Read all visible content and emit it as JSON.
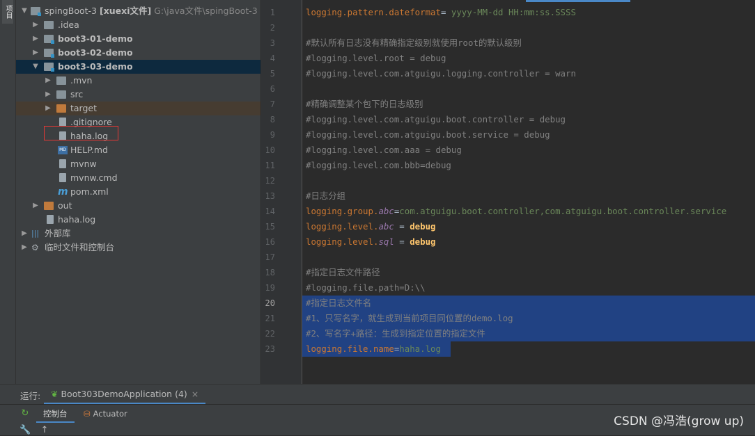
{
  "left_strip": {
    "tab": "项目"
  },
  "tree": {
    "root": {
      "name": "spingBoot-3",
      "tag": "[xuexi文件]",
      "path": "G:\\java文件\\spingBoot-3"
    },
    "idea": ".idea",
    "m1": "boot3-01-demo",
    "m2": "boot3-02-demo",
    "m3": "boot3-03-demo",
    "mvn": ".mvn",
    "src": "src",
    "target": "target",
    "gitignore": ".gitignore",
    "haha_inner": "haha.log",
    "help": "HELP.md",
    "mvnw": "mvnw",
    "mvnwcmd": "mvnw.cmd",
    "pom": "pom.xml",
    "out": "out",
    "haha_outer": "haha.log",
    "ext": "外部库",
    "scratch": "临时文件和控制台"
  },
  "editor": {
    "line_numbers": [
      "1",
      "2",
      "3",
      "4",
      "5",
      "6",
      "7",
      "8",
      "9",
      "10",
      "11",
      "12",
      "13",
      "14",
      "15",
      "16",
      "17",
      "18",
      "19",
      "20",
      "21",
      "22",
      "23"
    ],
    "current_line": "20",
    "l1_key": "logging.pattern.dateformat",
    "l1_eq": "= ",
    "l1_val": "yyyy-MM-dd HH:mm:ss.SSSS",
    "l3": "#默认所有日志没有精确指定级别就使用root的默认级别",
    "l4": "#logging.level.root = debug",
    "l5": "#logging.level.com.atguigu.logging.controller = warn",
    "l7": "#精确调整某个包下的日志级别",
    "l8": "#logging.level.com.atguigu.boot.controller = debug",
    "l9": "#logging.level.com.atguigu.boot.service = debug",
    "l10": "#logging.level.com.aaa = debug",
    "l11": "#logging.level.com.bbb=debug",
    "l13": "#日志分组",
    "l14_key": "logging.group.",
    "l14_ital": "abc",
    "l14_eq": "=",
    "l14_val": "com.atguigu.boot.controller,com.atguigu.boot.controller.service",
    "l15_key": "logging.level.",
    "l15_ital": "abc",
    "l15_eq": " = ",
    "l15_val": "debug",
    "l16_key": "logging.level.",
    "l16_ital": "sql",
    "l16_eq": " = ",
    "l16_val": "debug",
    "l18": "#指定日志文件路径",
    "l19": "#logging.file.path=D:\\\\",
    "l20": "#指定日志文件名",
    "l21": "#1、只写名字，就生成到当前项目同位置的demo.log",
    "l22": "#2、写名字+路径：生成到指定位置的指定文件",
    "l23_key": "logging.file.name",
    "l23_eq": "=",
    "l23_val": "haha.log"
  },
  "bottom": {
    "run_label": "运行:",
    "run_tab": "Boot303DemoApplication (4)",
    "console_tab": "控制台",
    "actuator_tab": "Actuator"
  },
  "watermark": "CSDN @冯浩(grow up)"
}
